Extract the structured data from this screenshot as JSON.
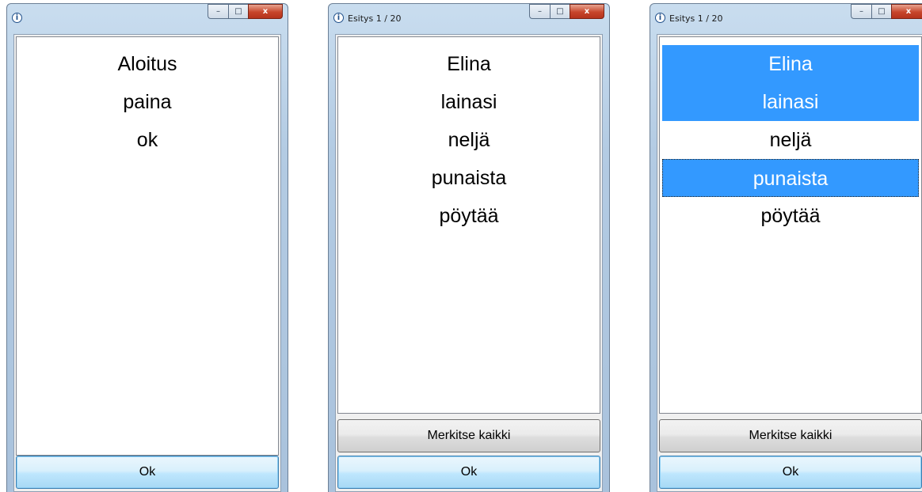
{
  "windows": [
    {
      "title": "",
      "list_items": [
        "Aloitus",
        "paina",
        "ok"
      ],
      "selected": [],
      "focused": null,
      "show_mark_all": false,
      "mark_all_label": "",
      "ok_label": "Ok"
    },
    {
      "title": "Esitys 1 / 20",
      "list_items": [
        "Elina",
        "lainasi",
        "neljä",
        "punaista",
        "pöytää"
      ],
      "selected": [],
      "focused": null,
      "show_mark_all": true,
      "mark_all_label": "Merkitse kaikki",
      "ok_label": "Ok"
    },
    {
      "title": "Esitys 1 / 20",
      "list_items": [
        "Elina",
        "lainasi",
        "neljä",
        "punaista",
        "pöytää"
      ],
      "selected": [
        0,
        1,
        3
      ],
      "focused": 3,
      "show_mark_all": true,
      "mark_all_label": "Merkitse kaikki",
      "ok_label": "Ok"
    }
  ],
  "caption_buttons": {
    "minimize": "–",
    "maximize": "□",
    "close": "x"
  },
  "app_icon_glyph": "i",
  "colors": {
    "selection": "#3399ff",
    "selection_text": "#ffffff"
  }
}
